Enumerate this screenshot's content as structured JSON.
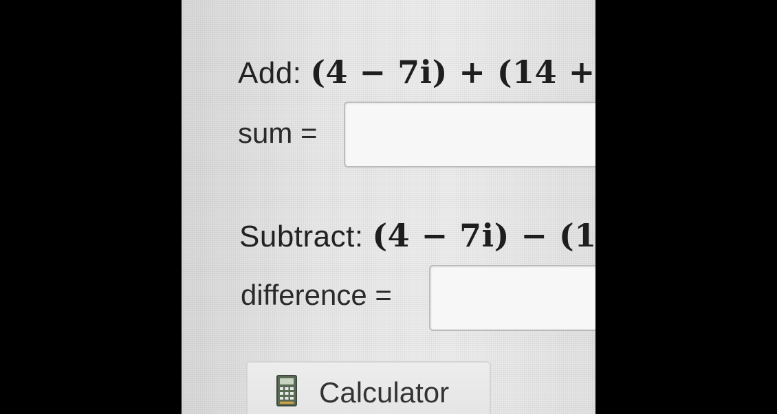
{
  "add_question": {
    "prefix": "Add:",
    "expression": "(4 − 7i) + (14 +"
  },
  "sum": {
    "label": "sum =",
    "value": ""
  },
  "subtract_question": {
    "prefix": "Subtract:",
    "expression": "(4 − 7i) − (1"
  },
  "difference": {
    "label": "difference =",
    "value": ""
  },
  "calculator_button": {
    "label": "Calculator",
    "icon": "calculator-icon"
  }
}
